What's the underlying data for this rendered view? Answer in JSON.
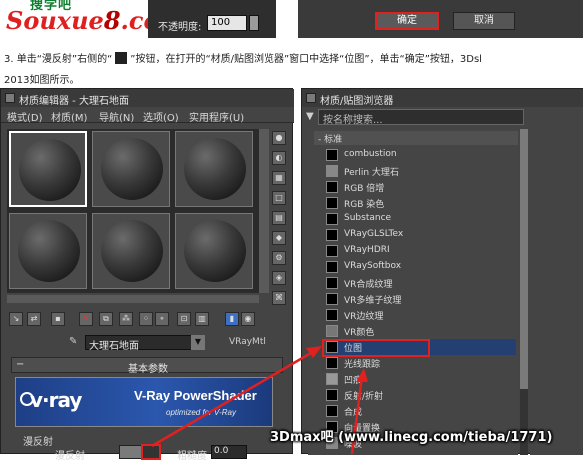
{
  "logo": {
    "line1": "搜学吧",
    "line2": "Souxue",
    "line2_num": "8",
    "line2_suffix": ".com"
  },
  "top_dialog": {
    "opacity_label": "不透明度:",
    "opacity_value": "100",
    "ok_label": "确定",
    "cancel_label": "取消"
  },
  "instructions": {
    "line1_part1": "3. 单击“漫反射”右侧的“",
    "line1_part2": "”按钮，在打开的“材质/贴图浏览器”窗口中选择“位图”，单击“确定”按钮，3Dsl",
    "line2": "2013如图所示。"
  },
  "material_editor": {
    "title": "材质编辑器 - 大理石地面",
    "menu": [
      "模式(D)",
      "材质(M)",
      "导航(N)",
      "选项(O)",
      "实用程序(U)"
    ],
    "material_name": "大理石地面",
    "material_type": "VRayMtl",
    "rollout_title": "基本参数",
    "vray_logo": "v·ray",
    "vray_title": "V-Ray PowerShader",
    "vray_subtitle": "optimized for V-Ray",
    "diffuse_group": "漫反射",
    "diffuse_label": "漫反射",
    "roughness_label": "粗糙度",
    "roughness_value": "0.0"
  },
  "map_browser": {
    "title": "材质/贴图浏览器",
    "search_placeholder": "按名称搜索...",
    "group_label": "- 标准",
    "items": [
      "combustion",
      "Perlin 大理石",
      "RGB 倍增",
      "RGB 染色",
      "Substance",
      "VRayGLSLTex",
      "VRayHDRI",
      "VRaySoftbox",
      "VR合成纹理",
      "VR多维子纹理",
      "VR边纹理",
      "VR颜色",
      "位图",
      "光线跟踪",
      "凹痕",
      "反射/折射",
      "合成",
      "向量置换",
      "噪波"
    ],
    "selected_item": "位图"
  },
  "watermark": "3Dmax吧 (www.linecg.com/tieba/1771)",
  "colors": {
    "accent_red": "#e12020",
    "selection_blue": "#243f71",
    "panel_bg": "#444444"
  }
}
